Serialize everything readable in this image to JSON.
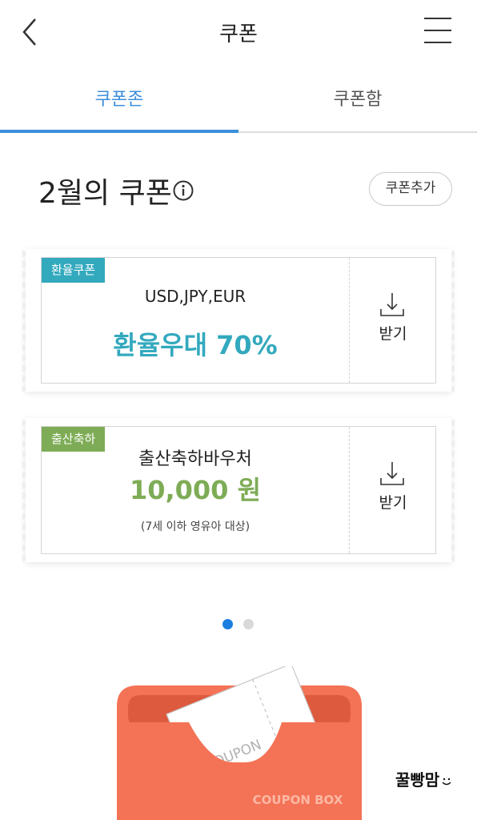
{
  "header": {
    "title": "쿠폰"
  },
  "tabs": [
    {
      "label": "쿠폰존"
    },
    {
      "label": "쿠폰함"
    }
  ],
  "section": {
    "title": "2월의 쿠폰",
    "add_button": "쿠폰추가"
  },
  "coupons": [
    {
      "tag": "환율쿠폰",
      "subtitle": "USD,JPY,EUR",
      "value": "환율우대 70%",
      "action": "받기"
    },
    {
      "tag": "출산축하",
      "subtitle": "출산축하바우처",
      "value": "10,000 원",
      "note": "(7세 이하 영유아 대상)",
      "action": "받기"
    }
  ],
  "pagination": {
    "current": 1,
    "total": 2
  },
  "promo": {
    "ticket_text": "COUPON",
    "box_text": "COUPON BOX"
  },
  "brand": "꿀빵맘",
  "colors": {
    "accent": "#3d8fdb",
    "teal": "#33a9be",
    "green": "#7eac56",
    "box": "#f47356"
  },
  "icons": [
    "back-arrow-icon",
    "hamburger-menu-icon",
    "info-icon",
    "download-icon",
    "smile-icon"
  ]
}
